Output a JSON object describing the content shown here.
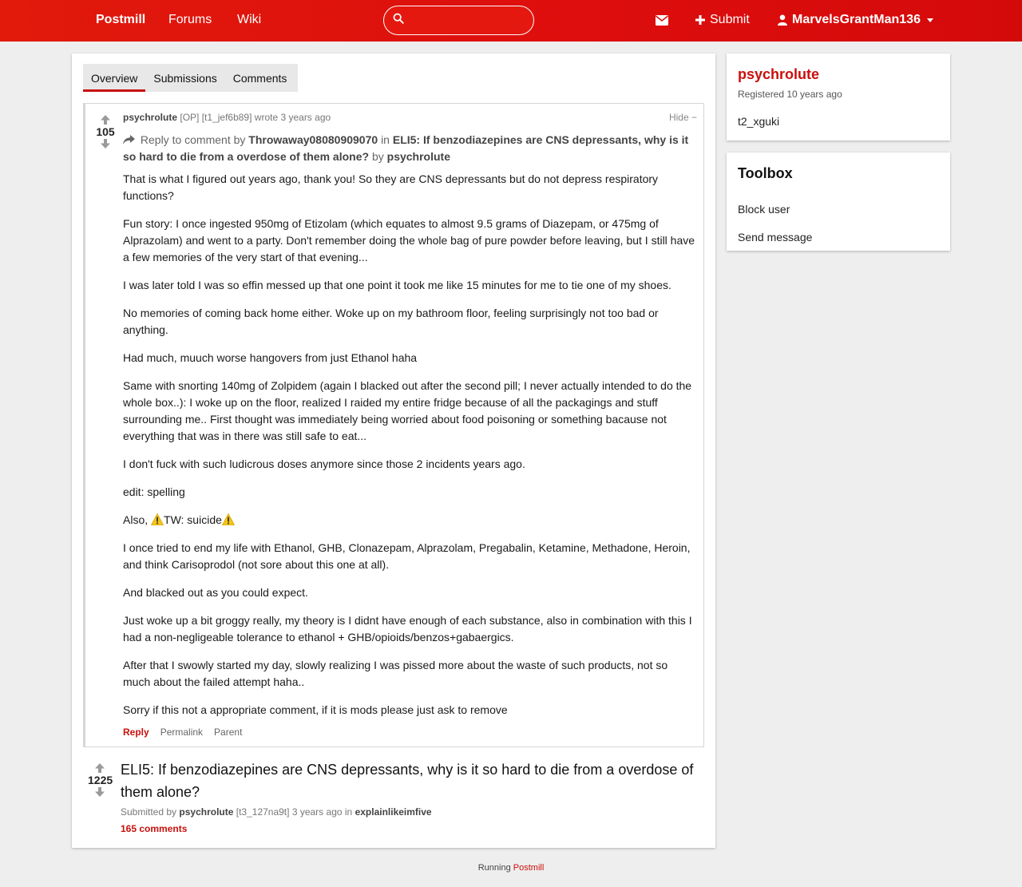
{
  "nav": {
    "brand": "Postmill",
    "forums": "Forums",
    "wiki": "Wiki",
    "search_placeholder": "",
    "submit": "Submit",
    "username": "MarvelsGrantMan136"
  },
  "tabs": [
    "Overview",
    "Submissions",
    "Comments"
  ],
  "comment": {
    "score": "105",
    "author": "psychrolute",
    "op": "[OP]",
    "id": "[t1_jef6b89]",
    "wrote": "wrote 3 years ago",
    "hide": "Hide −",
    "reply_prefix": "Reply to comment by",
    "reply_user": "Throwaway08080909070",
    "reply_in": "in",
    "reply_title": "ELI5: If benzodiazepines are CNS depressants, why is it so hard to die from a overdose of them alone?",
    "reply_by": "by",
    "reply_author": "psychrolute",
    "paragraphs": [
      "That is what I figured out years ago, thank you! So they are CNS depressants but do not depress respiratory functions?",
      "Fun story: I once ingested 950mg of Etizolam (which equates to almost 9.5 grams of Diazepam, or 475mg of Alprazolam) and went to a party. Don't remember doing the whole bag of pure powder before leaving, but I still have a few memories of the very start of that evening...",
      "I was later told I was so effin messed up that one point it took me like 15 minutes for me to tie one of my shoes.",
      "No memories of coming back home either. Woke up on my bathroom floor, feeling surprisingly not too bad or anything.",
      "Had much, muuch worse hangovers from just Ethanol haha",
      "Same with snorting 140mg of Zolpidem (again I blacked out after the second pill; I never actually intended to do the whole box..): I woke up on the floor, realized I raided my entire fridge because of all the packagings and stuff surrounding me.. First thought was immediately being worried about food poisoning or something bacause not everything that was in there was still safe to eat...",
      "I don't fuck with such ludicrous doses anymore since those 2 incidents years ago.",
      "edit: spelling"
    ],
    "also_prefix": "Also,",
    "also_text": "TW: suicide",
    "paragraphs2": [
      "I once tried to end my life with Ethanol, GHB, Clonazepam, Alprazolam, Pregabalin, Ketamine, Methadone, Heroin, and think Carisoprodol (not sore about this one at all).",
      "And blacked out as you could expect.",
      "Just woke up a bit groggy really, my theory is I didnt have enough of each substance, also in combination with this I had a non-negligeable tolerance to ethanol + GHB/opioids/benzos+gabaergics.",
      "After that I swowly started my day, slowly realizing I was pissed more about the waste of such products, not so much about the failed attempt haha..",
      "Sorry if this not a appropriate comment, if it is mods please just ask to remove"
    ],
    "actions": {
      "reply": "Reply",
      "permalink": "Permalink",
      "parent": "Parent"
    }
  },
  "submission": {
    "score": "1225",
    "title": "ELI5: If benzodiazepines are CNS depressants, why is it so hard to die from a overdose of them alone?",
    "submitted_by": "Submitted by",
    "author": "psychrolute",
    "id": "[t3_127na9t]",
    "age": "3 years ago in",
    "forum": "explainlikeimfive",
    "comments": "165 comments"
  },
  "sidebar": {
    "username": "psychrolute",
    "registered": "Registered 10 years ago",
    "user_id": "t2_xguki",
    "toolbox_title": "Toolbox",
    "block": "Block user",
    "message": "Send message"
  },
  "footer": {
    "running": "Running",
    "link": "Postmill"
  },
  "colors": {
    "brand_red": "#dd0d0d",
    "accent": "#c8100c",
    "warning": "#f5c518"
  }
}
